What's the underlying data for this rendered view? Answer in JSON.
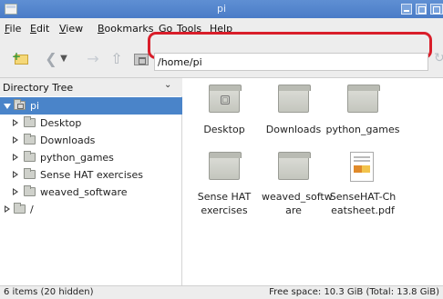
{
  "window": {
    "title": "pi"
  },
  "menu": [
    "File",
    "Edit",
    "View",
    "Bookmarks",
    "Go",
    "Tools",
    "Help"
  ],
  "toolbar": {
    "location": "/home/pi",
    "icons": [
      "new-tab-icon",
      "back-icon",
      "back-history-icon",
      "forward-icon",
      "up-icon",
      "home-icon",
      "go-icon"
    ],
    "highlight_color": "#d91e2a"
  },
  "sidebar": {
    "title": "Directory Tree",
    "tree": [
      {
        "label": "pi",
        "expanded": true,
        "selected": true
      },
      {
        "label": "Desktop"
      },
      {
        "label": "Downloads"
      },
      {
        "label": "python_games"
      },
      {
        "label": "Sense HAT exercises"
      },
      {
        "label": "weaved_software"
      },
      {
        "label": "/"
      }
    ]
  },
  "files": [
    {
      "label": "Desktop",
      "type": "desktop-folder"
    },
    {
      "label": "Downloads",
      "type": "folder"
    },
    {
      "label": "python_games",
      "type": "folder"
    },
    {
      "label": "Sense HAT exercises",
      "type": "folder"
    },
    {
      "label": "weaved_softw are",
      "type": "folder"
    },
    {
      "label": "SenseHAT-Cheatsheet.pdf",
      "type": "pdf"
    }
  ],
  "status": {
    "items": "6 items (20 hidden)",
    "free_space": "Free space: 10.3 GiB (Total: 13.8 GiB)"
  },
  "colors": {
    "selection": "#4a84c9",
    "titlebar": "#4a7cc7"
  }
}
